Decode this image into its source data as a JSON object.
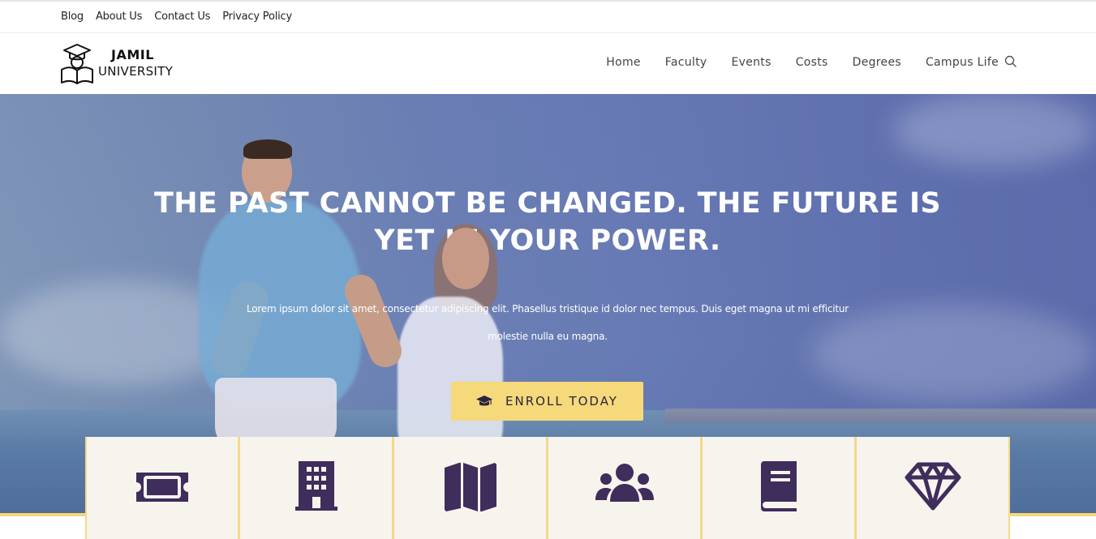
{
  "topbar": {
    "links": [
      "Blog",
      "About Us",
      "Contact Us",
      "Privacy Policy"
    ]
  },
  "header": {
    "logo_line1": "JAMIL",
    "logo_line2": "UNIVERSITY",
    "nav": [
      "Home",
      "Faculty",
      "Events",
      "Costs",
      "Degrees",
      "Campus Life"
    ],
    "search_icon": "search-icon"
  },
  "hero": {
    "headline": "THE PAST CANNOT BE CHANGED. THE FUTURE IS YET IN YOUR POWER.",
    "lead": "Lorem ipsum dolor sit amet, consectetur adipiscing elit. Phasellus tristique id dolor nec tempus. Duis eget magna ut mi efficitur molestie nulla eu magna.",
    "cta_label": "ENROLL TODAY",
    "cta_icon": "graduation-cap-icon"
  },
  "cards": [
    {
      "icon": "ticket-icon"
    },
    {
      "icon": "building-icon"
    },
    {
      "icon": "map-icon"
    },
    {
      "icon": "users-icon"
    },
    {
      "icon": "book-icon"
    },
    {
      "icon": "diamond-icon"
    }
  ],
  "colors": {
    "accent": "#f5d97a",
    "icon": "#3f2d5c",
    "card_bg": "#f7f4ee"
  }
}
